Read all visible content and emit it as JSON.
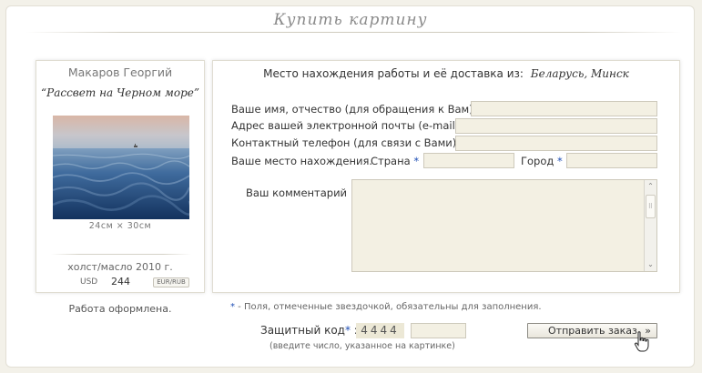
{
  "header": {
    "title": "Купить картину"
  },
  "artwork": {
    "artist": "Макаров Георгий",
    "title": "“Рассвет на Черном море”",
    "dimensions": "24см × 30см",
    "medium": "холст/масло 2010 г.",
    "currency": "USD",
    "price": "244",
    "currency_switch": "EUR/RUB",
    "framed_note": "Работа оформлена."
  },
  "form": {
    "delivery_label": "Место нахождения работы и её доставка из:",
    "delivery_location": "Беларусь, Минск",
    "name_label": "Ваше имя, отчество (для обращения к Вам)",
    "email_label": "Адрес вашей электронной почты (e-mail)",
    "phone_label": "Контактный телефон (для связи с Вами)",
    "location_label": "Ваше место нахождения.",
    "country_label": "Страна",
    "city_label": "Город",
    "comment_label": "Ваш комментарий :",
    "required_mark": "*",
    "colon": " :",
    "required_note": " - Поля, отмеченные звездочкой, обязательны для заполнения.",
    "captcha_label": "Защитный код",
    "captcha_code": "4444",
    "captcha_hint": "(введите число, указанное на картинке)",
    "submit_label": "Отправить заказ",
    "submit_arrow": "»"
  },
  "icons": {
    "scroll_up": "up-arrows-icon",
    "scroll_down": "down-arrows-icon",
    "cursor": "hand-pointer-icon"
  },
  "colors": {
    "star": "#1f4fb5",
    "input_bg": "#f3f0e3",
    "page_bg": "#f3f1e9"
  }
}
